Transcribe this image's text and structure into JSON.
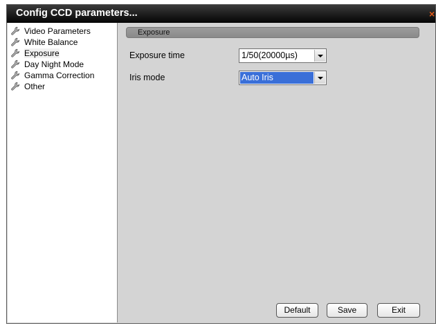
{
  "window": {
    "title": "Config CCD parameters...",
    "close_glyph": "×"
  },
  "sidebar": {
    "items": [
      {
        "label": "Video Parameters",
        "icon": "wrench-icon"
      },
      {
        "label": "White Balance",
        "icon": "wrench-icon"
      },
      {
        "label": "Exposure",
        "icon": "wrench-icon",
        "selected": true
      },
      {
        "label": "Day Night Mode",
        "icon": "wrench-icon"
      },
      {
        "label": "Gamma Correction",
        "icon": "wrench-icon"
      },
      {
        "label": "Other",
        "icon": "wrench-icon"
      }
    ]
  },
  "main": {
    "section_title": "Exposure",
    "fields": {
      "exposure_time": {
        "label": "Exposure time",
        "value": "1/50(20000µs)"
      },
      "iris_mode": {
        "label": "Iris mode",
        "value": "Auto Iris"
      }
    }
  },
  "buttons": {
    "default_label": "Default",
    "save_label": "Save",
    "exit_label": "Exit"
  },
  "colors": {
    "titlebar": "#000000",
    "panel_bg": "#d4d4d4",
    "selection_blue": "#3a6fd8",
    "close_accent": "#e05a1a"
  }
}
